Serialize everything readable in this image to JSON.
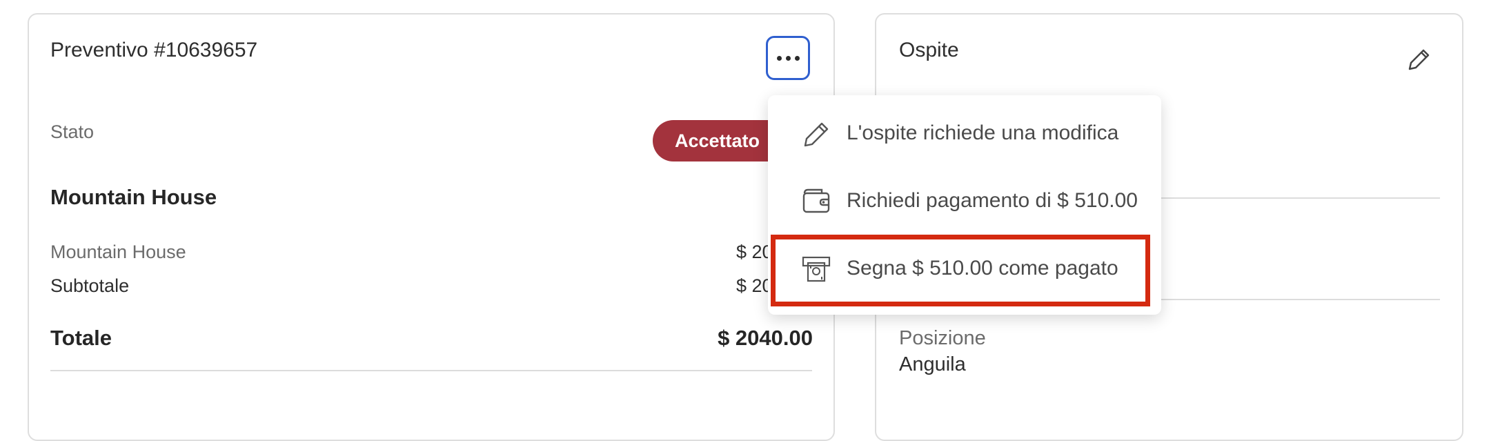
{
  "quote": {
    "title": "Preventivo #10639657",
    "status_label": "Stato",
    "status_value": "Accettato",
    "property_heading": "Mountain House",
    "line_item_name": "Mountain House",
    "line_item_amount": "$ 20",
    "subtotal_label": "Subtotale",
    "subtotal_amount": "$ 20",
    "total_label": "Totale",
    "total_amount": "$ 2040.00"
  },
  "more_menu": {
    "icon": "more-horizontal-icon",
    "items": [
      {
        "icon": "pencil-icon",
        "label": "L'ospite richiede una modifica"
      },
      {
        "icon": "wallet-icon",
        "label": "Richiedi pagamento di $ 510.00"
      },
      {
        "icon": "cash-icon",
        "label": "Segna $ 510.00 come pagato"
      }
    ],
    "highlight_color": "#d42a10"
  },
  "guest": {
    "title": "Ospite",
    "edit_icon": "pencil-icon",
    "position_label": "Posizione",
    "position_value": "Anguila"
  },
  "colors": {
    "status_badge": "#a3333d",
    "focus_ring": "#2f5fcf"
  }
}
